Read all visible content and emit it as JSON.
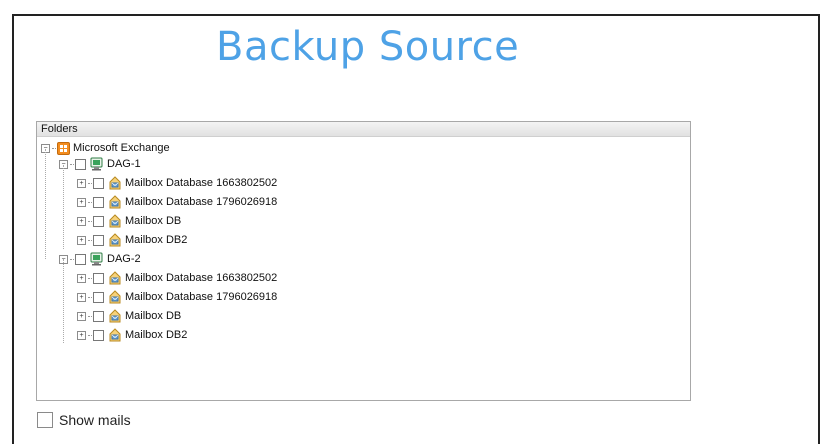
{
  "page": {
    "title": "Backup Source"
  },
  "folders_panel": {
    "header": "Folders"
  },
  "tree": {
    "root": {
      "label": "Microsoft Exchange",
      "icon": "exchange-icon"
    },
    "groups": [
      {
        "label": "DAG-1",
        "icon": "server-icon",
        "items": [
          {
            "label": "Mailbox Database 1663802502",
            "icon": "mailbox-database-icon"
          },
          {
            "label": "Mailbox Database 1796026918",
            "icon": "mailbox-database-icon"
          },
          {
            "label": "Mailbox DB",
            "icon": "mailbox-database-icon"
          },
          {
            "label": "Mailbox DB2",
            "icon": "mailbox-database-icon"
          }
        ]
      },
      {
        "label": "DAG-2",
        "icon": "server-icon",
        "items": [
          {
            "label": "Mailbox Database 1663802502",
            "icon": "mailbox-database-icon"
          },
          {
            "label": "Mailbox Database 1796026918",
            "icon": "mailbox-database-icon"
          },
          {
            "label": "Mailbox DB",
            "icon": "mailbox-database-icon"
          },
          {
            "label": "Mailbox DB2",
            "icon": "mailbox-database-icon"
          }
        ]
      }
    ]
  },
  "options": {
    "show_mails_label": "Show mails",
    "show_mails_checked": false
  },
  "colors": {
    "title": "#4ea2e6",
    "exchange_icon": "#f28c1e",
    "server_icon": "#3aa35b"
  }
}
